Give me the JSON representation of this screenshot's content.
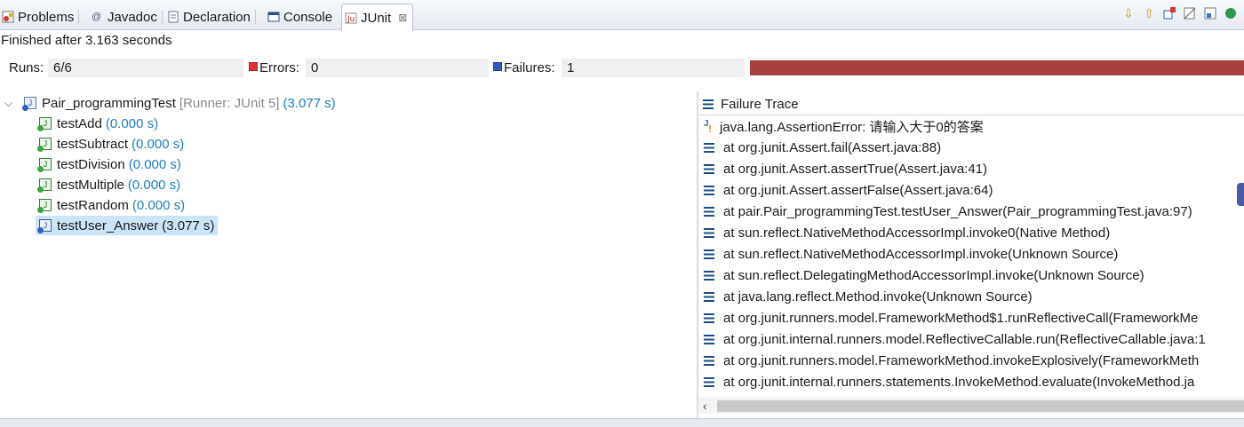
{
  "tabs": [
    {
      "label": "Problems",
      "icon": "problems-icon",
      "active": false
    },
    {
      "label": "Javadoc",
      "icon": "javadoc-icon",
      "active": false
    },
    {
      "label": "Declaration",
      "icon": "declaration-icon",
      "active": false
    },
    {
      "label": "Console",
      "icon": "console-icon",
      "active": false
    },
    {
      "label": "JUnit",
      "icon": "junit-icon",
      "active": true
    }
  ],
  "toolbar_icons": [
    "next-failure-icon",
    "previous-failure-icon",
    "stop-icon",
    "history-icon",
    "layout-icon",
    "view-menu-icon"
  ],
  "status": "Finished after 3.163 seconds",
  "counters": {
    "runs_label": "Runs:",
    "runs_value": "6/6",
    "errors_label": "Errors:",
    "errors_value": "0",
    "failures_label": "Failures:",
    "failures_value": "1"
  },
  "progress": {
    "fraction": 1.0,
    "color": "#a6403f"
  },
  "tree": {
    "root": {
      "name": "Pair_programmingTest",
      "runner": "[Runner: JUnit 5]",
      "time": "(3.077 s)"
    },
    "tests": [
      {
        "name": "testAdd",
        "time": "(0.000 s)",
        "status": "passed"
      },
      {
        "name": "testSubtract",
        "time": "(0.000 s)",
        "status": "passed"
      },
      {
        "name": "testDivision",
        "time": "(0.000 s)",
        "status": "passed"
      },
      {
        "name": "testMultiple",
        "time": "(0.000 s)",
        "status": "passed"
      },
      {
        "name": "testRandom",
        "time": "(0.000 s)",
        "status": "passed"
      },
      {
        "name": "testUser_Answer",
        "time": "(3.077 s)",
        "status": "failed",
        "selected": true
      }
    ]
  },
  "trace": {
    "header": "Failure Trace",
    "message": "java.lang.AssertionError: 请输入大于0的答案",
    "lines": [
      "at org.junit.Assert.fail(Assert.java:88)",
      "at org.junit.Assert.assertTrue(Assert.java:41)",
      "at org.junit.Assert.assertFalse(Assert.java:64)",
      "at pair.Pair_programmingTest.testUser_Answer(Pair_programmingTest.java:97)",
      "at sun.reflect.NativeMethodAccessorImpl.invoke0(Native Method)",
      "at sun.reflect.NativeMethodAccessorImpl.invoke(Unknown Source)",
      "at sun.reflect.DelegatingMethodAccessorImpl.invoke(Unknown Source)",
      "at java.lang.reflect.Method.invoke(Unknown Source)",
      "at org.junit.runners.model.FrameworkMethod$1.runReflectiveCall(FrameworkMe",
      "at org.junit.internal.runners.model.ReflectiveCallable.run(ReflectiveCallable.java:1",
      "at org.junit.runners.model.FrameworkMethod.invokeExplosively(FrameworkMeth",
      "at org.junit.internal.runners.statements.InvokeMethod.evaluate(InvokeMethod.ja"
    ]
  }
}
